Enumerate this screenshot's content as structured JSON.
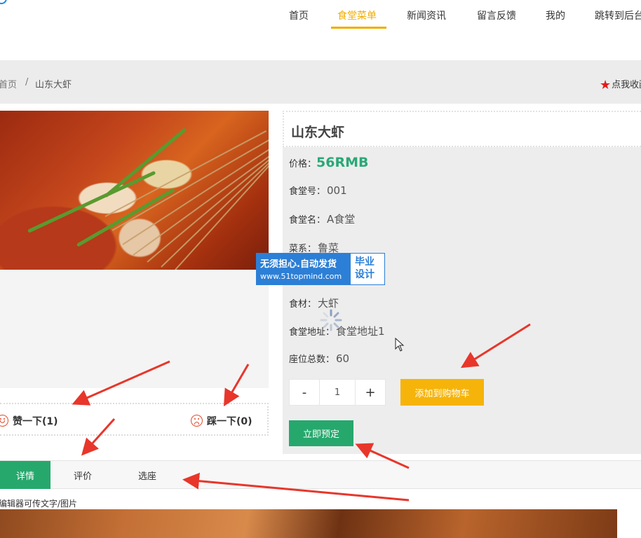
{
  "nav": {
    "items": [
      "首页",
      "食堂菜单",
      "新闻资讯",
      "留言反馈",
      "我的",
      "跳转到后台"
    ],
    "active_index": 1
  },
  "breadcrumb": {
    "home": "首页",
    "separator": "/",
    "current": "山东大虾"
  },
  "favorite": {
    "label": "点我收藏"
  },
  "vote": {
    "like_label": "赞一下(1)",
    "dislike_label": "踩一下(0)"
  },
  "product": {
    "title": "山东大虾",
    "price_label": "价格：",
    "price": "56RMB",
    "fields": [
      {
        "label": "食堂号：",
        "value": "001"
      },
      {
        "label": "食堂名：",
        "value": "A食堂"
      },
      {
        "label": "菜系：",
        "value": "鲁菜"
      },
      {
        "label": "食材：",
        "value": "大虾"
      },
      {
        "label": "食堂地址：",
        "value": "食堂地址1"
      },
      {
        "label": "座位总数：",
        "value": "60"
      }
    ]
  },
  "quantity": {
    "minus": "-",
    "value": "1",
    "plus": "+"
  },
  "buttons": {
    "add_to_cart": "添加到购物车",
    "book_now": "立即预定"
  },
  "tabs": [
    "详情",
    "评价",
    "选座"
  ],
  "active_tab": 0,
  "detail": {
    "editor_note": "编辑器可传文字/图片"
  },
  "watermark": {
    "line1": "无须担心.自动发货",
    "line2": "www.51topmind.com",
    "badge_line1": "毕业",
    "badge_line2": "设计"
  },
  "colors": {
    "accent": "#f0ad00",
    "price": "#2aa876",
    "cart_button": "#f6b40a",
    "book_button": "#26a86d",
    "annotation_arrow": "#e8362b"
  },
  "icons": {
    "favorite": "star-icon",
    "like": "smile-face-icon",
    "dislike": "sad-face-icon",
    "loading": "spinner-icon",
    "pointer": "mouse-cursor-icon"
  }
}
